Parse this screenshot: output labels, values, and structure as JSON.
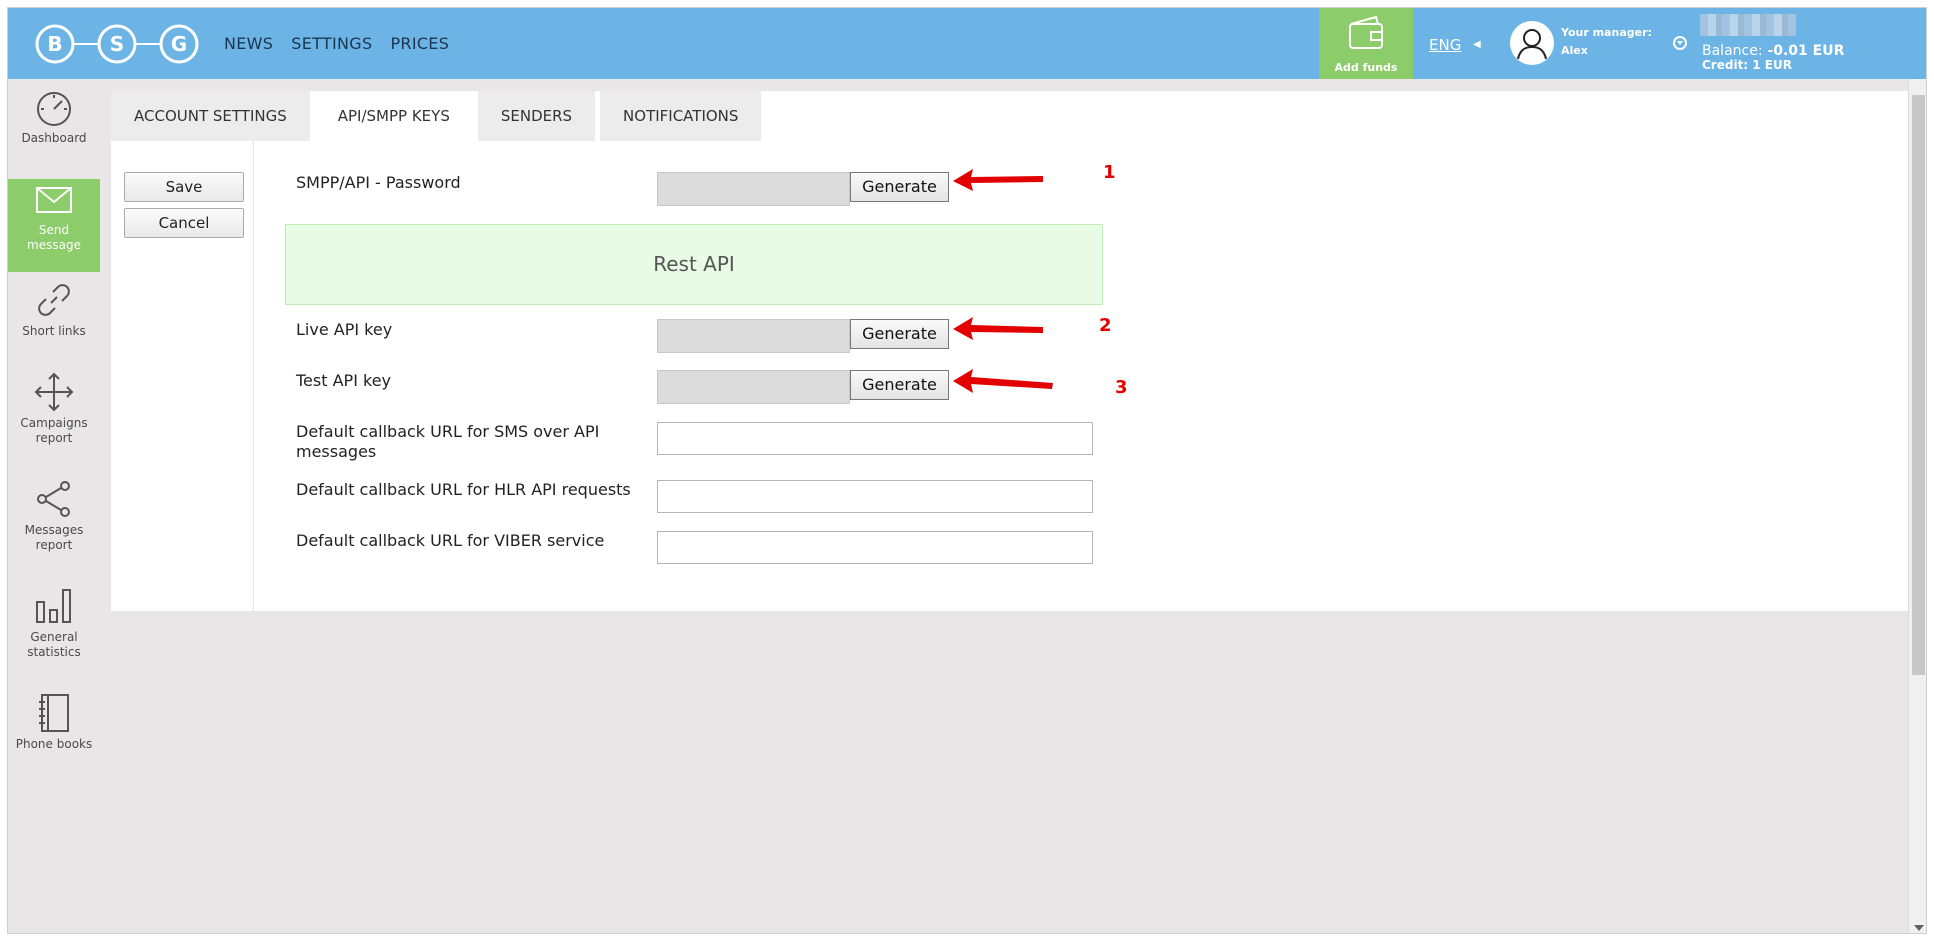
{
  "header": {
    "logo_letters": [
      "B",
      "S",
      "G"
    ],
    "nav": [
      "NEWS",
      "SETTINGS",
      "PRICES"
    ],
    "add_funds": "Add funds",
    "language": "ENG",
    "manager_label": "Your manager:",
    "manager_name": "Alex",
    "balance_label": "Balance:",
    "balance_value": "-0.01 EUR",
    "credit": "Credit: 1 EUR"
  },
  "sidebar": [
    {
      "label": "Dashboard",
      "icon": "speedometer-icon",
      "active": false
    },
    {
      "label": "Send message",
      "icon": "envelope-icon",
      "active": true
    },
    {
      "label": "Short links",
      "icon": "link-icon",
      "active": false
    },
    {
      "label": "Campaigns report",
      "icon": "move-arrows-icon",
      "active": false
    },
    {
      "label": "Messages report",
      "icon": "share-icon",
      "active": false
    },
    {
      "label": "General statistics",
      "icon": "bar-chart-icon",
      "active": false
    },
    {
      "label": "Phone books",
      "icon": "notebook-icon",
      "active": false
    }
  ],
  "tabs": [
    {
      "label": "ACCOUNT SETTINGS",
      "active": false
    },
    {
      "label": "API/SMPP KEYS",
      "active": true
    },
    {
      "label": "SENDERS",
      "active": false
    },
    {
      "label": "NOTIFICATIONS",
      "active": false
    }
  ],
  "actions": {
    "save": "Save",
    "cancel": "Cancel"
  },
  "form": {
    "smpp_password_label": "SMPP/API - Password",
    "generate": "Generate",
    "rest_api_title": "Rest API",
    "live_key_label": "Live API key",
    "test_key_label": "Test API key",
    "callback_sms_label": "Default callback URL for SMS over API messages",
    "callback_hlr_label": "Default callback URL for HLR API requests",
    "callback_viber_label": "Default callback URL for VIBER service"
  },
  "annotations": [
    "1",
    "2",
    "3"
  ],
  "colors": {
    "header": "#6cb4e6",
    "accent_green": "#8ccc6a",
    "rest_api_bg": "#e8fbe4",
    "arrow": "#e20000"
  }
}
